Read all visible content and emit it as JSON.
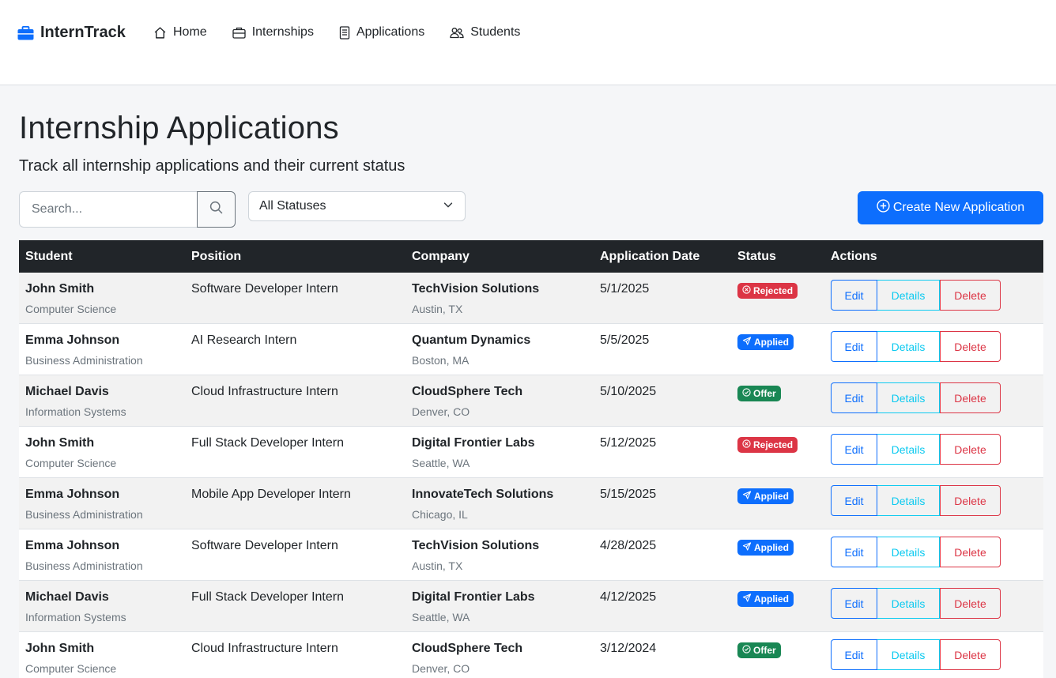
{
  "brand": {
    "name": "InternTrack",
    "icon": "briefcase-icon",
    "color": "#0d6efd"
  },
  "nav": [
    {
      "label": "Home",
      "icon": "home-icon"
    },
    {
      "label": "Internships",
      "icon": "briefcase-outline-icon"
    },
    {
      "label": "Applications",
      "icon": "document-icon"
    },
    {
      "label": "Students",
      "icon": "people-icon"
    }
  ],
  "header": {
    "title": "Internship Applications",
    "subtitle": "Track all internship applications and their current status"
  },
  "controls": {
    "search_placeholder": "Search...",
    "search_value": "",
    "status_filter": "All Statuses",
    "create_label": "Create New Application"
  },
  "table": {
    "columns": [
      "Student",
      "Position",
      "Company",
      "Application Date",
      "Status",
      "Actions"
    ],
    "action_labels": {
      "edit": "Edit",
      "details": "Details",
      "delete": "Delete"
    },
    "rows": [
      {
        "student": "John Smith",
        "major": "Computer Science",
        "position": "Software Developer Intern",
        "company": "TechVision Solutions",
        "location": "Austin, TX",
        "date": "5/1/2025",
        "status": "Rejected",
        "status_key": "rejected"
      },
      {
        "student": "Emma Johnson",
        "major": "Business Administration",
        "position": "AI Research Intern",
        "company": "Quantum Dynamics",
        "location": "Boston, MA",
        "date": "5/5/2025",
        "status": "Applied",
        "status_key": "applied"
      },
      {
        "student": "Michael Davis",
        "major": "Information Systems",
        "position": "Cloud Infrastructure Intern",
        "company": "CloudSphere Tech",
        "location": "Denver, CO",
        "date": "5/10/2025",
        "status": "Offer",
        "status_key": "offer"
      },
      {
        "student": "John Smith",
        "major": "Computer Science",
        "position": "Full Stack Developer Intern",
        "company": "Digital Frontier Labs",
        "location": "Seattle, WA",
        "date": "5/12/2025",
        "status": "Rejected",
        "status_key": "rejected"
      },
      {
        "student": "Emma Johnson",
        "major": "Business Administration",
        "position": "Mobile App Developer Intern",
        "company": "InnovateTech Solutions",
        "location": "Chicago, IL",
        "date": "5/15/2025",
        "status": "Applied",
        "status_key": "applied"
      },
      {
        "student": "Emma Johnson",
        "major": "Business Administration",
        "position": "Software Developer Intern",
        "company": "TechVision Solutions",
        "location": "Austin, TX",
        "date": "4/28/2025",
        "status": "Applied",
        "status_key": "applied"
      },
      {
        "student": "Michael Davis",
        "major": "Information Systems",
        "position": "Full Stack Developer Intern",
        "company": "Digital Frontier Labs",
        "location": "Seattle, WA",
        "date": "4/12/2025",
        "status": "Applied",
        "status_key": "applied"
      },
      {
        "student": "John Smith",
        "major": "Computer Science",
        "position": "Cloud Infrastructure Intern",
        "company": "CloudSphere Tech",
        "location": "Denver, CO",
        "date": "3/12/2024",
        "status": "Offer",
        "status_key": "offer"
      }
    ]
  },
  "colors": {
    "primary": "#0d6efd",
    "info": "#0dcaf0",
    "danger": "#dc3545",
    "success": "#198754",
    "table_header": "#212529"
  }
}
